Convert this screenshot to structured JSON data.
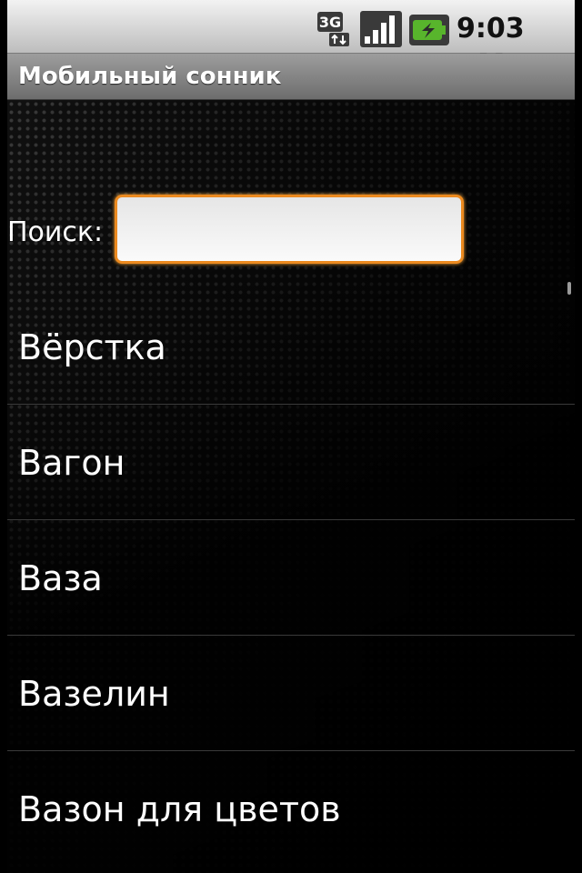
{
  "status_bar": {
    "network_type": "3G",
    "time": "9:03 AM",
    "icons": [
      "network-3g-icon",
      "signal-strength-icon",
      "battery-charging-icon"
    ]
  },
  "title_bar": {
    "title": "Мобильный сонник"
  },
  "search": {
    "label": "Поиск:",
    "value": "",
    "placeholder": ""
  },
  "list": {
    "items": [
      {
        "label": "Вёрстка"
      },
      {
        "label": "Вагон"
      },
      {
        "label": "Ваза"
      },
      {
        "label": "Вазелин"
      },
      {
        "label": "Вазон для цветов"
      }
    ]
  },
  "colors": {
    "accent_focus": "#ec8a1f",
    "background": "#000000",
    "title_bar": "#8a8a8a",
    "battery_green": "#58b52c"
  }
}
